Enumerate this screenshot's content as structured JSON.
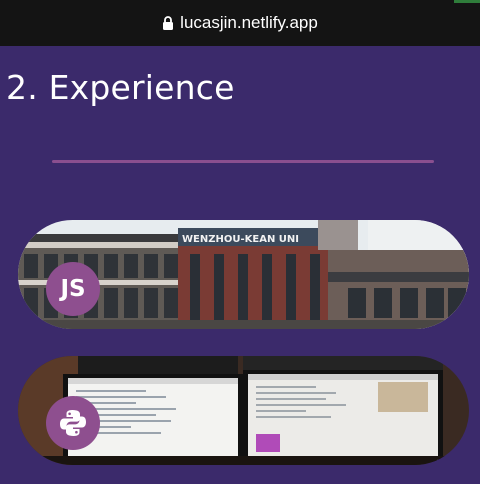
{
  "browser": {
    "url": "lucasjin.netlify.app",
    "lock_icon": "lock-icon"
  },
  "section": {
    "title": "2. Experience",
    "accent_color": "#8a4f8f"
  },
  "cards": [
    {
      "badge_text": "JS",
      "image": "campus-building-photo",
      "sign_text": "WENZHOU-KEAN UNI"
    },
    {
      "badge_icon": "python-icon",
      "image": "dual-monitor-desk-photo"
    }
  ]
}
